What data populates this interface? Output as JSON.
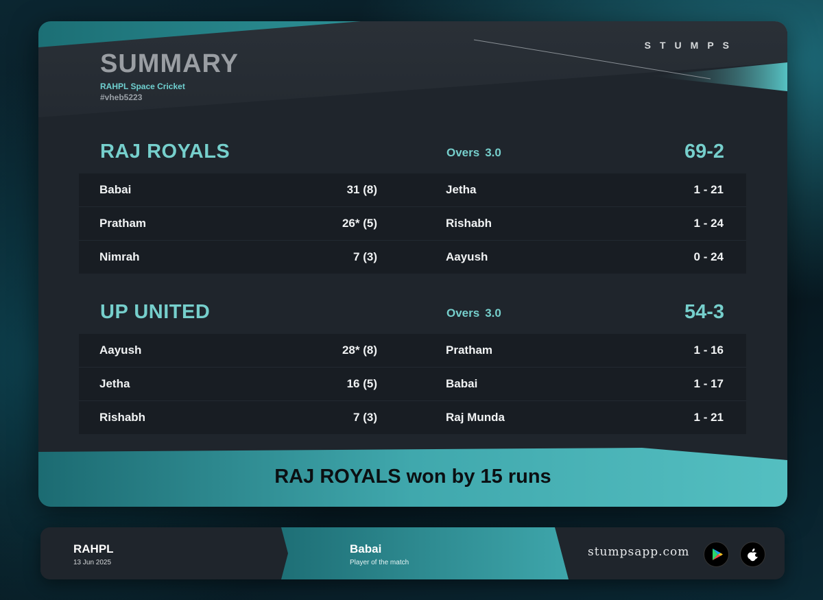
{
  "summary": {
    "title": "SUMMARY",
    "subtitle": "RAHPL Space Cricket",
    "hashtag": "#vheb5223",
    "brand": "STUMPS"
  },
  "innings": [
    {
      "team": "RAJ ROYALS",
      "overs_label": "Overs",
      "overs": "3.0",
      "total": "69-2",
      "rows": [
        {
          "batter": "Babai",
          "bat_score": "31 (8)",
          "bowler": "Jetha",
          "bowl_figures": "1 - 21"
        },
        {
          "batter": "Pratham",
          "bat_score": "26* (5)",
          "bowler": "Rishabh",
          "bowl_figures": "1 - 24"
        },
        {
          "batter": "Nimrah",
          "bat_score": "7 (3)",
          "bowler": "Aayush",
          "bowl_figures": "0 - 24"
        }
      ]
    },
    {
      "team": "UP UNITED",
      "overs_label": "Overs",
      "overs": "3.0",
      "total": "54-3",
      "rows": [
        {
          "batter": "Aayush",
          "bat_score": "28* (8)",
          "bowler": "Pratham",
          "bowl_figures": "1 - 16"
        },
        {
          "batter": "Jetha",
          "bat_score": "16 (5)",
          "bowler": "Babai",
          "bowl_figures": "1 - 17"
        },
        {
          "batter": "Rishabh",
          "bat_score": "7 (3)",
          "bowler": "Raj Munda",
          "bowl_figures": "1 - 21"
        }
      ]
    }
  ],
  "result": "RAJ ROYALS won by 15 runs",
  "footer": {
    "league": "RAHPL",
    "date": "13 Jun 2025",
    "player_of_match": "Babai",
    "player_of_match_label": "Player of the match",
    "website": "stumpsapp.com",
    "store_icons": [
      "google-play-icon",
      "apple-icon"
    ]
  },
  "colors": {
    "accent": "#76cfcc",
    "card": "#1f252c",
    "row": "#181d23",
    "teal_band": "#3fa9ae"
  }
}
